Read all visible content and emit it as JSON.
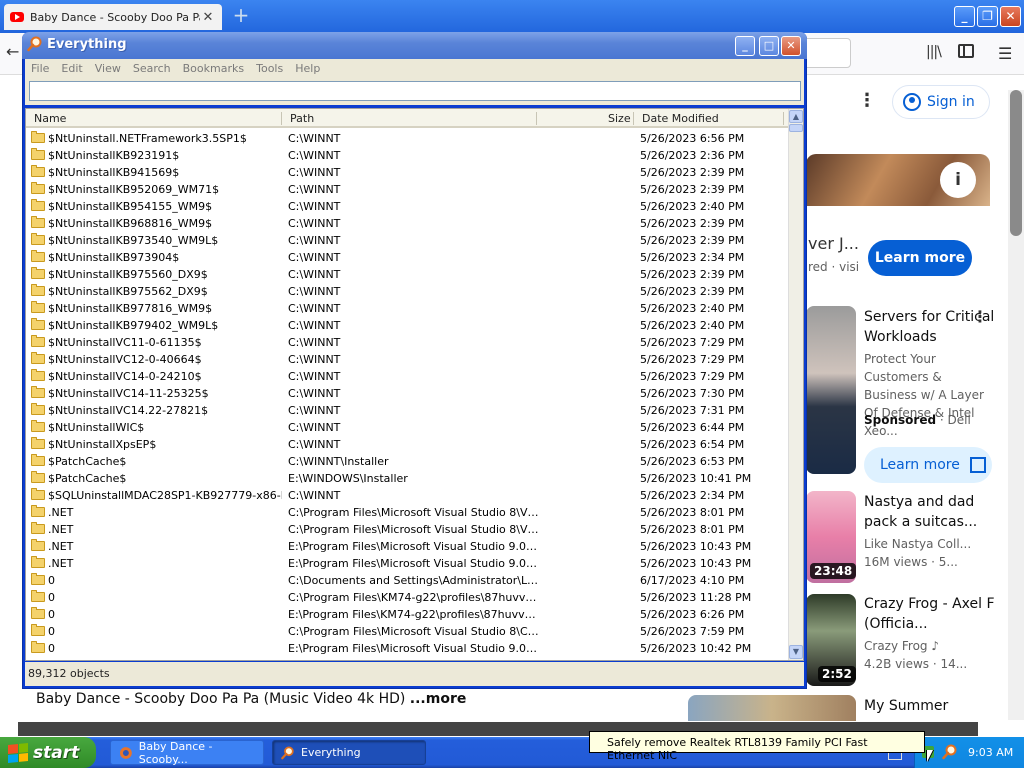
{
  "browser": {
    "tab_title": "Baby Dance - Scooby Doo Pa Pa (",
    "tab_close": "✕",
    "new_tab": "+",
    "sign_in_label": "Sign in",
    "kebab": "⋮",
    "ad": {
      "title_partial": "ver J...",
      "meta_partial": "red · visi",
      "learn_more_label": "Learn more",
      "info": "i"
    },
    "recommendations": [
      {
        "title": "Servers for Critical Workloads",
        "description": "Protect Your Customers & Business w/ A Layer Of Defense & Intel Xeo...",
        "sponsored": "Sponsored",
        "sponsor": "· Dell",
        "cta": "Learn more"
      },
      {
        "title": "Nastya and dad pack a suitcas...",
        "channel": "Like Nastya Coll...",
        "views": "16M views · 5...",
        "duration": "23:48"
      },
      {
        "title": "Crazy Frog - Axel F (Officia...",
        "channel": "Crazy Frog ♪",
        "views": "4.2B views · 14...",
        "duration": "2:52"
      },
      {
        "title": "My Summer"
      }
    ],
    "video_title": "Baby Dance - Scooby Doo Pa Pa (Music Video 4k HD)",
    "video_more": "...more",
    "colors": {
      "titlebar": "#2266dd",
      "accent": "#065fd4"
    }
  },
  "everything": {
    "title": "Everything",
    "menu": [
      "File",
      "Edit",
      "View",
      "Search",
      "Bookmarks",
      "Tools",
      "Help"
    ],
    "search_value": "",
    "columns": {
      "name": "Name",
      "path": "Path",
      "size": "Size",
      "date": "Date Modified"
    },
    "rows": [
      [
        "$NtUninstall.NETFramework3.5SP1$",
        "C:\\WINNT",
        "5/26/2023 6:56 PM"
      ],
      [
        "$NtUninstallKB923191$",
        "C:\\WINNT",
        "5/26/2023 2:36 PM"
      ],
      [
        "$NtUninstallKB941569$",
        "C:\\WINNT",
        "5/26/2023 2:39 PM"
      ],
      [
        "$NtUninstallKB952069_WM71$",
        "C:\\WINNT",
        "5/26/2023 2:39 PM"
      ],
      [
        "$NtUninstallKB954155_WM9$",
        "C:\\WINNT",
        "5/26/2023 2:40 PM"
      ],
      [
        "$NtUninstallKB968816_WM9$",
        "C:\\WINNT",
        "5/26/2023 2:39 PM"
      ],
      [
        "$NtUninstallKB973540_WM9L$",
        "C:\\WINNT",
        "5/26/2023 2:39 PM"
      ],
      [
        "$NtUninstallKB973904$",
        "C:\\WINNT",
        "5/26/2023 2:34 PM"
      ],
      [
        "$NtUninstallKB975560_DX9$",
        "C:\\WINNT",
        "5/26/2023 2:39 PM"
      ],
      [
        "$NtUninstallKB975562_DX9$",
        "C:\\WINNT",
        "5/26/2023 2:39 PM"
      ],
      [
        "$NtUninstallKB977816_WM9$",
        "C:\\WINNT",
        "5/26/2023 2:40 PM"
      ],
      [
        "$NtUninstallKB979402_WM9L$",
        "C:\\WINNT",
        "5/26/2023 2:40 PM"
      ],
      [
        "$NtUninstallVC11-0-61135$",
        "C:\\WINNT",
        "5/26/2023 7:29 PM"
      ],
      [
        "$NtUninstallVC12-0-40664$",
        "C:\\WINNT",
        "5/26/2023 7:29 PM"
      ],
      [
        "$NtUninstallVC14-0-24210$",
        "C:\\WINNT",
        "5/26/2023 7:29 PM"
      ],
      [
        "$NtUninstallVC14-11-25325$",
        "C:\\WINNT",
        "5/26/2023 7:30 PM"
      ],
      [
        "$NtUninstallVC14.22-27821$",
        "C:\\WINNT",
        "5/26/2023 7:31 PM"
      ],
      [
        "$NtUninstallWIC$",
        "C:\\WINNT",
        "5/26/2023 6:44 PM"
      ],
      [
        "$NtUninstallXpsEP$",
        "C:\\WINNT",
        "5/26/2023 6:54 PM"
      ],
      [
        "$PatchCache$",
        "C:\\WINNT\\Installer",
        "5/26/2023 6:53 PM"
      ],
      [
        "$PatchCache$",
        "E:\\WINDOWS\\Installer",
        "5/26/2023 10:41 PM"
      ],
      [
        "$SQLUninstallMDAC28SP1-KB927779-x86-ENU$",
        "C:\\WINNT",
        "5/26/2023 2:34 PM"
      ],
      [
        ".NET",
        "C:\\Program Files\\Microsoft Visual Studio 8\\VC\\VC...",
        "5/26/2023 8:01 PM"
      ],
      [
        ".NET",
        "C:\\Program Files\\Microsoft Visual Studio 8\\VC\\VC...",
        "5/26/2023 8:01 PM"
      ],
      [
        ".NET",
        "E:\\Program Files\\Microsoft Visual Studio 9.0\\VC\\V...",
        "5/26/2023 10:43 PM"
      ],
      [
        ".NET",
        "E:\\Program Files\\Microsoft Visual Studio 9.0\\VC\\V...",
        "5/26/2023 10:43 PM"
      ],
      [
        "0",
        "C:\\Documents and Settings\\Administrator\\Local S...",
        "6/17/2023 4:10 PM"
      ],
      [
        "0",
        "C:\\Program Files\\KM74-g22\\profiles\\87huvv4p.d...",
        "5/26/2023 11:28 PM"
      ],
      [
        "0",
        "E:\\Program Files\\KM74-g22\\profiles\\87huvv4p.d...",
        "5/26/2023 6:26 PM"
      ],
      [
        "0",
        "C:\\Program Files\\Microsoft Visual Studio 8\\Comm...",
        "5/26/2023 7:59 PM"
      ],
      [
        "0",
        "E:\\Program Files\\Microsoft Visual Studio 9.0\\Com...",
        "5/26/2023 10:42 PM"
      ]
    ],
    "status": "89,312 objects"
  },
  "taskbar": {
    "start_label": "start",
    "tasks": [
      "Baby Dance - Scooby...",
      "Everything"
    ],
    "tooltip": "Safely remove Realtek RTL8139 Family PCI Fast Ethernet NIC",
    "clock": "9:03 AM"
  }
}
